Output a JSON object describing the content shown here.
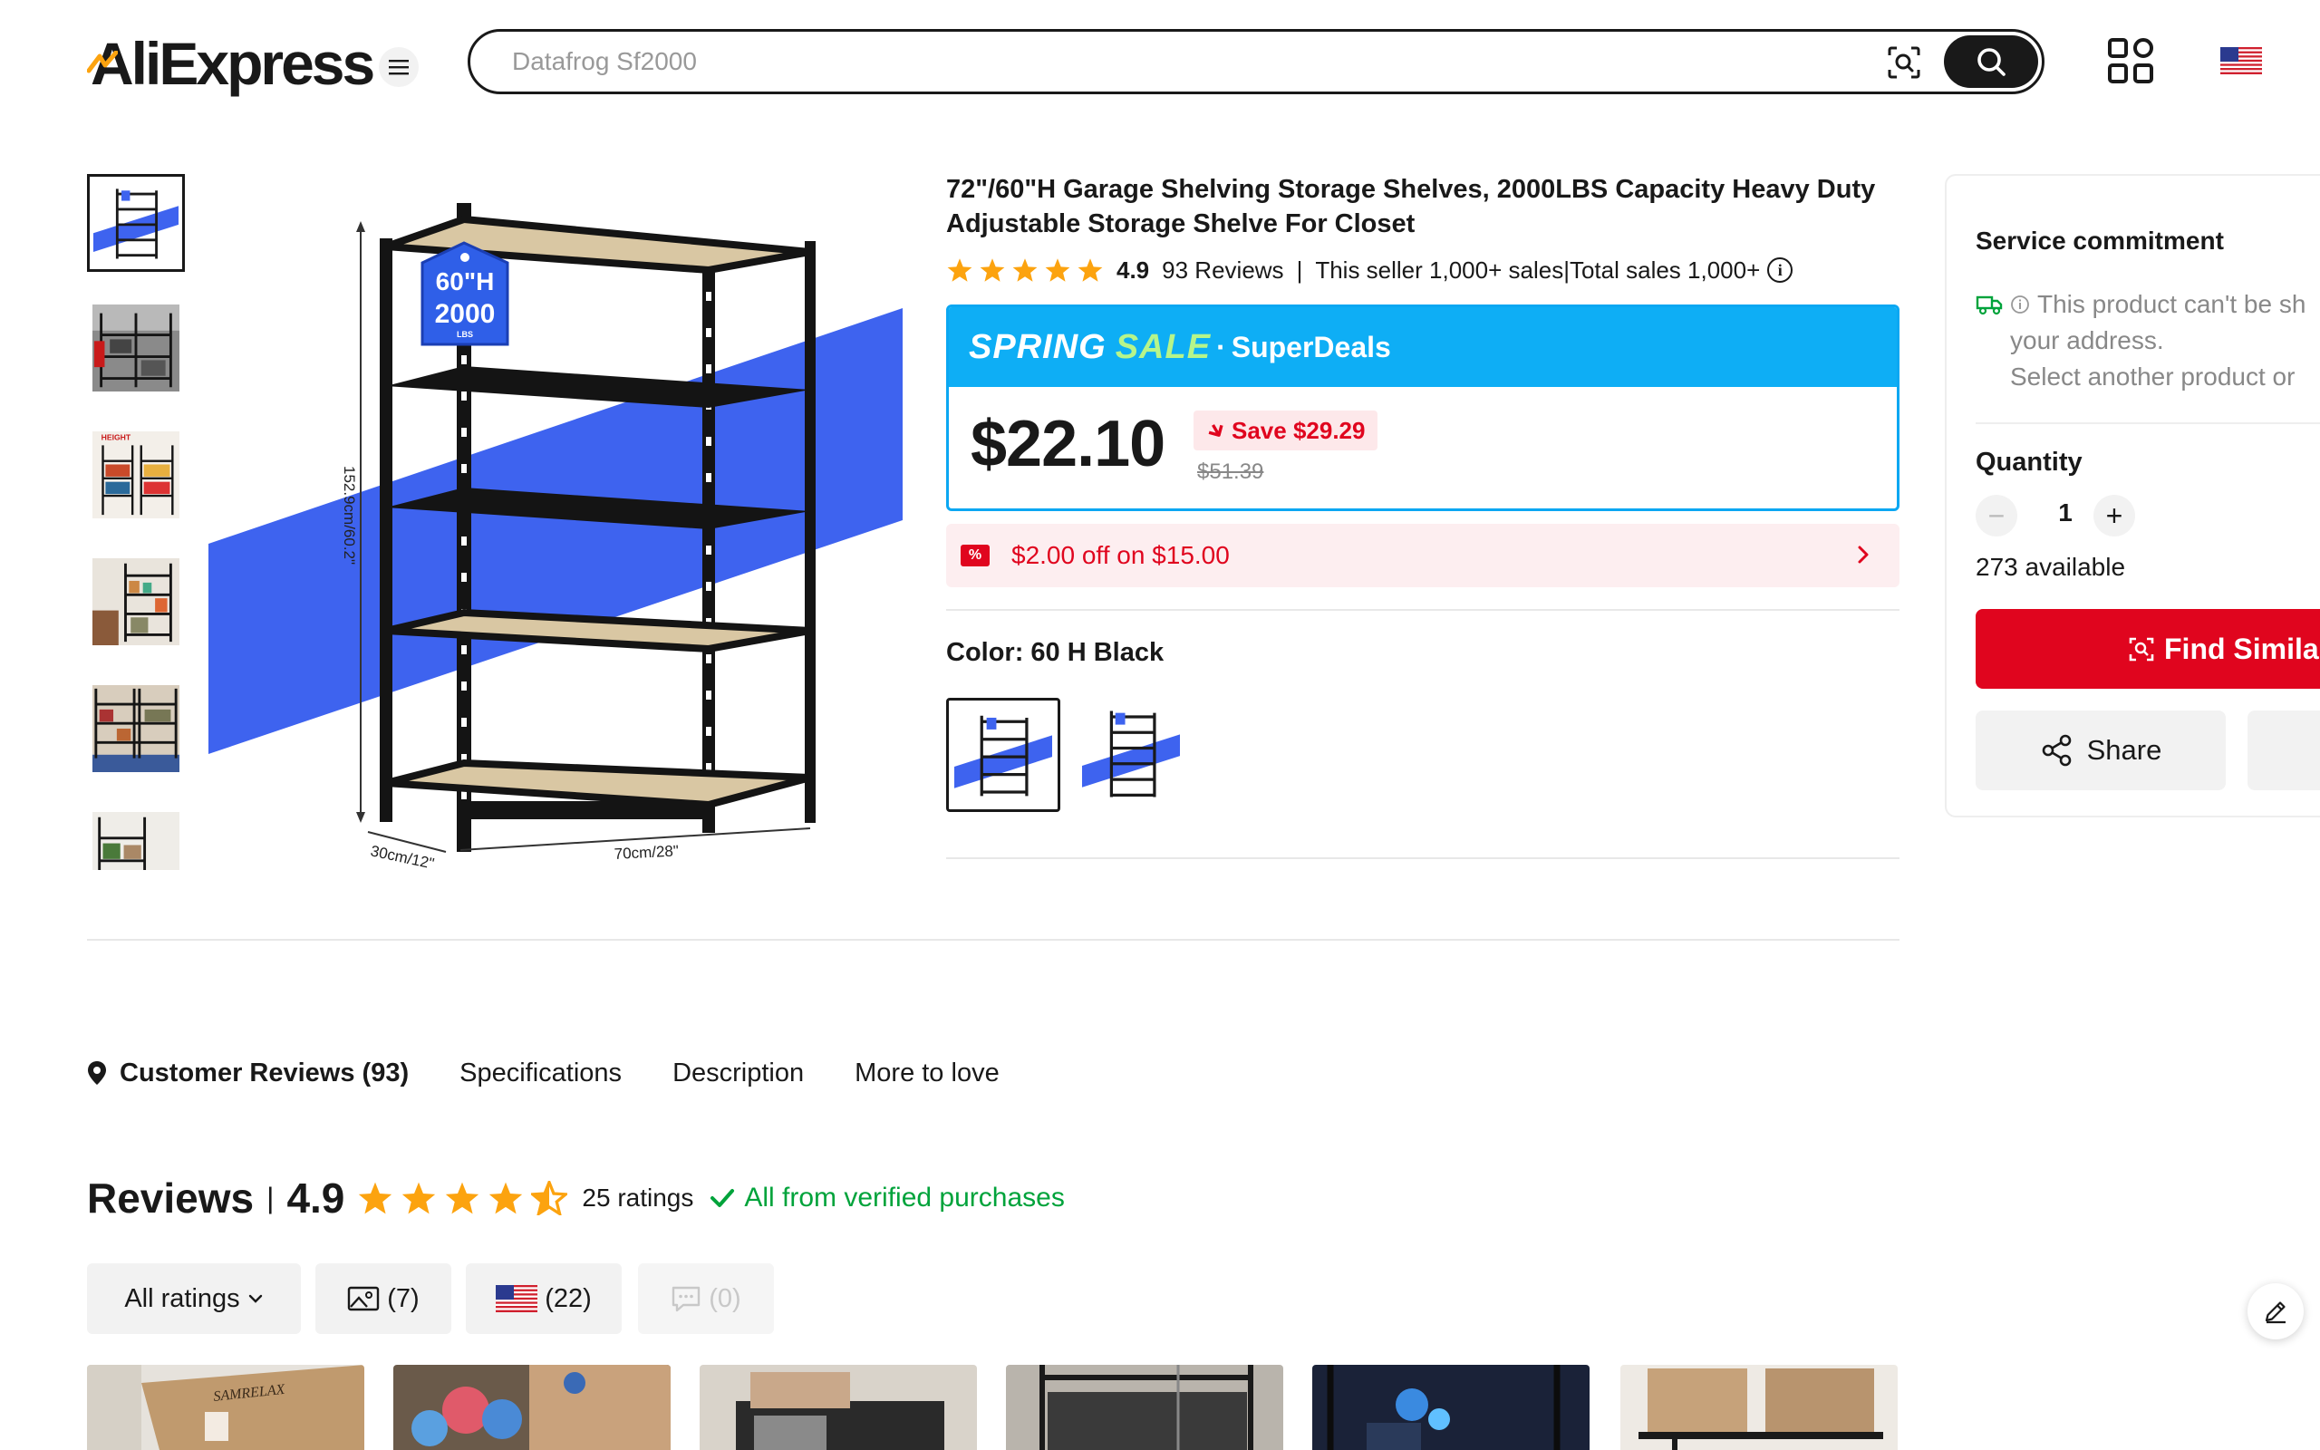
{
  "header": {
    "logo_text": "AliExpress",
    "search_placeholder": "Datafrog Sf2000",
    "menu_icon": "hamburger-icon",
    "camera_icon": "image-search-icon",
    "search_icon": "search-icon",
    "qr_icon": "qr-code-icon",
    "flag_icon": "us-flag-icon"
  },
  "gallery": {
    "main_badge_line1": "60\"H",
    "main_badge_line2": "2000",
    "main_badge_line3": "LBS",
    "dim_height": "152.9cm/60.2\"",
    "dim_depth": "30cm/12\"",
    "dim_width": "70cm/28\"",
    "thumb_top_label": "HEIGHT",
    "thumbnails": 6
  },
  "product": {
    "title": "72\"/60\"H Garage Shelving Storage Shelves,   2000LBS Capacity Heavy Duty Adjustable Storage Shelve For Closet",
    "rating": "4.9",
    "reviews_count": "93 Reviews",
    "seller_sales": "This seller 1,000+ sales",
    "total_sales": "Total sales 1,000+",
    "sale": {
      "spring": "SPRING",
      "sale": "SALE",
      "dot": "·",
      "superdeals": "SuperDeals",
      "price": "$22.10",
      "save": "Save $29.29",
      "old_price": "$51.39"
    },
    "coupon": {
      "badge": "%",
      "text": "$2.00 off on $15.00"
    },
    "color_label": "Color: 60 H Black"
  },
  "panel": {
    "service_title": "Service commitment",
    "ship_line1": "This product can't be sh",
    "ship_line2": "your address.",
    "ship_line3": "Select another product or",
    "quantity_label": "Quantity",
    "quantity_minus": "−",
    "quantity_value": "1",
    "quantity_plus": "+",
    "available": "273 available",
    "find_similar": "Find Similar",
    "share": "Share"
  },
  "tabs": [
    {
      "label": "Customer Reviews (93)"
    },
    {
      "label": "Specifications"
    },
    {
      "label": "Description"
    },
    {
      "label": "More to love"
    }
  ],
  "reviews": {
    "title": "Reviews",
    "sep": "|",
    "score": "4.9",
    "ratings": "25 ratings",
    "verified": "All from verified purchases",
    "filters": {
      "all": "All ratings",
      "photos": "(7)",
      "country": "(22)",
      "comments": "(0)"
    },
    "review_img_text": "SAMRELAX"
  },
  "colors": {
    "accent_red": "#e0051e",
    "sale_blue": "#0eaef5",
    "star_orange": "#fca30f",
    "verified_green": "#00a33b",
    "promo_blue": "#3e63ef"
  }
}
